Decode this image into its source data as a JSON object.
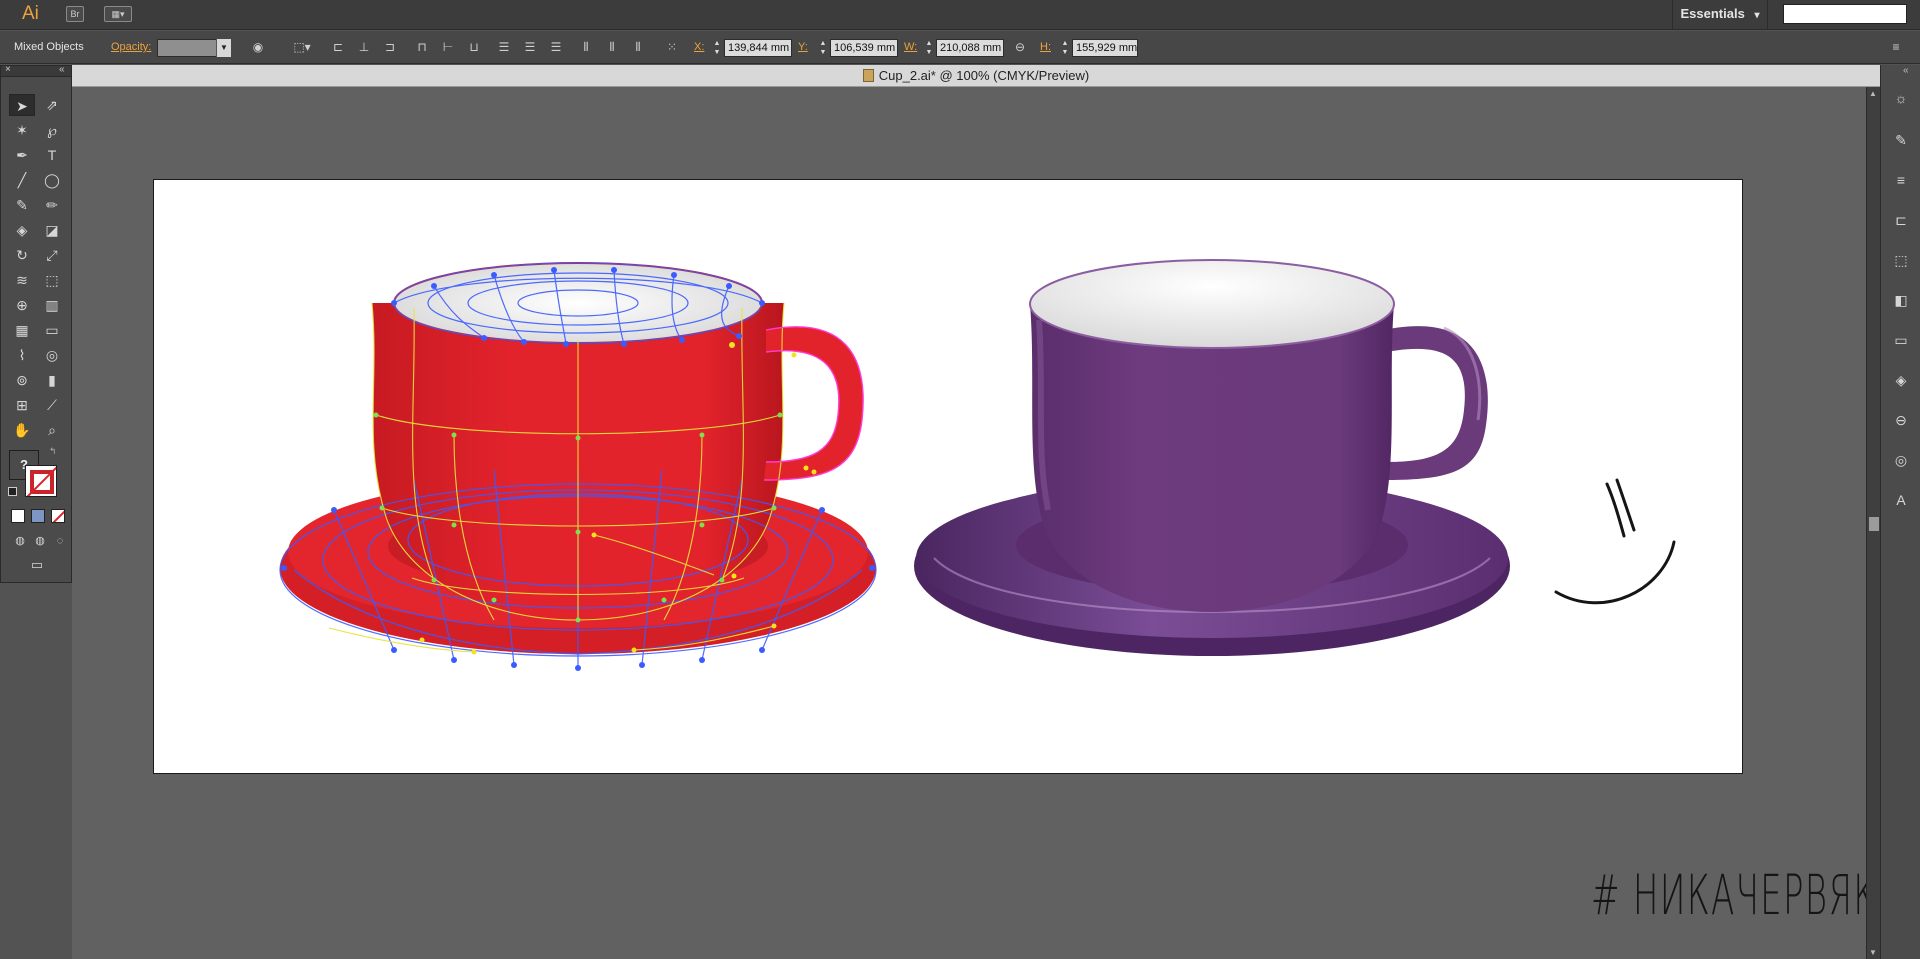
{
  "app": {
    "logo": "Ai",
    "bridge_label": "Br",
    "workspace": "Essentials",
    "workspace_arrow": "▾"
  },
  "control_bar": {
    "selection_label": "Mixed Objects",
    "opacity_label": "Opacity:",
    "opacity_value": "",
    "x_label": "X:",
    "x_value": "139,844 mm",
    "y_label": "Y:",
    "y_value": "106,539 mm",
    "w_label": "W:",
    "w_value": "210,088 mm",
    "h_label": "H:",
    "h_value": "155,929 mm"
  },
  "document": {
    "title": "Cup_2.ai* @ 100% (CMYK/Preview)"
  },
  "artwork": {
    "hashtag": "# НИКАЧЕРВЯК",
    "red_cup_color": "#e3232c",
    "purple_cup_color": "#6a3a7a",
    "mesh_color": "#3b5bff",
    "mesh_line_color": "#e8e23a"
  },
  "tools": {
    "unknown_label": "?"
  },
  "colors": {
    "accent": "#e8a33d",
    "panel": "#4b4b4b",
    "canvas": "#616161"
  }
}
